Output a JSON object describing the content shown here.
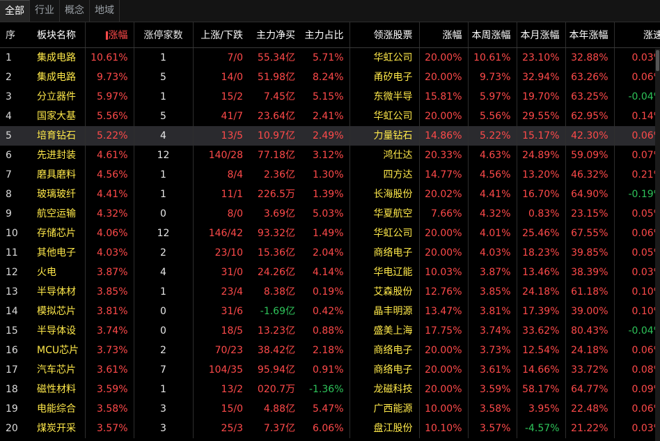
{
  "tabs": [
    "全部",
    "行业",
    "概念",
    "地域"
  ],
  "headers": {
    "idx": "序",
    "name": "板块名称",
    "change": "涨幅",
    "limit_up": "涨停家数",
    "up_down": "上涨/下跌",
    "net_inflow": "主力净买",
    "net_ratio": "主力占比",
    "leader": "领涨股票",
    "leader_change": "涨幅",
    "week": "本周涨幅",
    "month": "本月涨幅",
    "year": "本年涨幅",
    "speed": "涨速"
  },
  "rows": [
    {
      "idx": "1",
      "name": "集成电路",
      "change": "10.61%",
      "limit_up": "1",
      "up_down": "7/0",
      "net_inflow": "55.34亿",
      "net_ratio": "5.71%",
      "leader": "华虹公司",
      "leader_change": "20.00%",
      "week": "10.61%",
      "month": "23.10%",
      "year": "32.88%",
      "speed": "0.03%"
    },
    {
      "idx": "2",
      "name": "集成电路",
      "change": "9.73%",
      "limit_up": "5",
      "up_down": "14/0",
      "net_inflow": "51.98亿",
      "net_ratio": "8.24%",
      "leader": "甬矽电子",
      "leader_change": "20.00%",
      "week": "9.73%",
      "month": "32.94%",
      "year": "63.26%",
      "speed": "0.06%"
    },
    {
      "idx": "3",
      "name": "分立器件",
      "change": "5.97%",
      "limit_up": "1",
      "up_down": "15/2",
      "net_inflow": "7.45亿",
      "net_ratio": "5.15%",
      "leader": "东微半导",
      "leader_change": "15.81%",
      "week": "5.97%",
      "month": "19.70%",
      "year": "63.25%",
      "speed": "-0.04%"
    },
    {
      "idx": "4",
      "name": "国家大基",
      "change": "5.56%",
      "limit_up": "5",
      "up_down": "41/7",
      "net_inflow": "23.64亿",
      "net_ratio": "2.41%",
      "leader": "华虹公司",
      "leader_change": "20.00%",
      "week": "5.56%",
      "month": "29.55%",
      "year": "62.95%",
      "speed": "0.14%"
    },
    {
      "idx": "5",
      "name": "培育钻石",
      "change": "5.22%",
      "limit_up": "4",
      "up_down": "13/5",
      "net_inflow": "10.97亿",
      "net_ratio": "2.49%",
      "leader": "力量钻石",
      "leader_change": "14.86%",
      "week": "5.22%",
      "month": "15.17%",
      "year": "42.30%",
      "speed": "0.06%"
    },
    {
      "idx": "6",
      "name": "先进封装",
      "change": "4.61%",
      "limit_up": "12",
      "up_down": "140/28",
      "net_inflow": "77.18亿",
      "net_ratio": "3.12%",
      "leader": "鸿仕达",
      "leader_change": "20.33%",
      "week": "4.63%",
      "month": "24.89%",
      "year": "59.09%",
      "speed": "0.07%"
    },
    {
      "idx": "7",
      "name": "磨具磨料",
      "change": "4.56%",
      "limit_up": "1",
      "up_down": "8/4",
      "net_inflow": "2.36亿",
      "net_ratio": "1.30%",
      "leader": "四方达",
      "leader_change": "14.77%",
      "week": "4.56%",
      "month": "13.20%",
      "year": "46.32%",
      "speed": "0.21%"
    },
    {
      "idx": "8",
      "name": "玻璃玻纤",
      "change": "4.41%",
      "limit_up": "1",
      "up_down": "11/1",
      "net_inflow": "226.5万",
      "net_ratio": "1.39%",
      "leader": "长海股份",
      "leader_change": "20.02%",
      "week": "4.41%",
      "month": "16.70%",
      "year": "64.90%",
      "speed": "-0.19%"
    },
    {
      "idx": "9",
      "name": "航空运输",
      "change": "4.32%",
      "limit_up": "0",
      "up_down": "8/0",
      "net_inflow": "3.69亿",
      "net_ratio": "5.03%",
      "leader": "华夏航空",
      "leader_change": "7.66%",
      "week": "4.32%",
      "month": "0.83%",
      "year": "23.15%",
      "speed": "0.05%"
    },
    {
      "idx": "10",
      "name": "存储芯片",
      "change": "4.06%",
      "limit_up": "12",
      "up_down": "146/42",
      "net_inflow": "93.32亿",
      "net_ratio": "1.49%",
      "leader": "华虹公司",
      "leader_change": "20.00%",
      "week": "4.01%",
      "month": "25.46%",
      "year": "67.55%",
      "speed": "0.06%"
    },
    {
      "idx": "11",
      "name": "其他电子",
      "change": "4.03%",
      "limit_up": "2",
      "up_down": "23/10",
      "net_inflow": "15.36亿",
      "net_ratio": "2.04%",
      "leader": "商络电子",
      "leader_change": "20.00%",
      "week": "4.03%",
      "month": "18.23%",
      "year": "39.85%",
      "speed": "0.05%"
    },
    {
      "idx": "12",
      "name": "火电",
      "change": "3.87%",
      "limit_up": "4",
      "up_down": "31/0",
      "net_inflow": "24.26亿",
      "net_ratio": "4.14%",
      "leader": "华电辽能",
      "leader_change": "10.03%",
      "week": "3.87%",
      "month": "13.46%",
      "year": "38.39%",
      "speed": "0.03%"
    },
    {
      "idx": "13",
      "name": "半导体材",
      "change": "3.85%",
      "limit_up": "1",
      "up_down": "23/4",
      "net_inflow": "8.38亿",
      "net_ratio": "0.19%",
      "leader": "艾森股份",
      "leader_change": "12.76%",
      "week": "3.85%",
      "month": "24.18%",
      "year": "61.18%",
      "speed": "0.10%"
    },
    {
      "idx": "14",
      "name": "模拟芯片",
      "change": "3.81%",
      "limit_up": "0",
      "up_down": "31/6",
      "net_inflow": "-1.69亿",
      "net_ratio": "0.42%",
      "leader": "晶丰明源",
      "leader_change": "13.47%",
      "week": "3.81%",
      "month": "17.39%",
      "year": "39.00%",
      "speed": "0.10%"
    },
    {
      "idx": "15",
      "name": "半导体设",
      "change": "3.74%",
      "limit_up": "0",
      "up_down": "18/5",
      "net_inflow": "13.23亿",
      "net_ratio": "0.88%",
      "leader": "盛美上海",
      "leader_change": "17.75%",
      "week": "3.74%",
      "month": "33.62%",
      "year": "80.43%",
      "speed": "-0.04%"
    },
    {
      "idx": "16",
      "name": "MCU芯片",
      "change": "3.73%",
      "limit_up": "2",
      "up_down": "70/23",
      "net_inflow": "38.42亿",
      "net_ratio": "2.18%",
      "leader": "商络电子",
      "leader_change": "20.00%",
      "week": "3.73%",
      "month": "12.54%",
      "year": "24.18%",
      "speed": "0.06%"
    },
    {
      "idx": "17",
      "name": "汽车芯片",
      "change": "3.61%",
      "limit_up": "7",
      "up_down": "104/35",
      "net_inflow": "95.94亿",
      "net_ratio": "0.91%",
      "leader": "商络电子",
      "leader_change": "20.00%",
      "week": "3.61%",
      "month": "14.66%",
      "year": "33.72%",
      "speed": "0.08%"
    },
    {
      "idx": "18",
      "name": "磁性材料",
      "change": "3.59%",
      "limit_up": "1",
      "up_down": "13/2",
      "net_inflow": "020.7万",
      "net_ratio": "-1.36%",
      "leader": "龙磁科技",
      "leader_change": "20.00%",
      "week": "3.59%",
      "month": "58.17%",
      "year": "64.77%",
      "speed": "0.09%"
    },
    {
      "idx": "19",
      "name": "电能综合",
      "change": "3.58%",
      "limit_up": "3",
      "up_down": "15/0",
      "net_inflow": "4.88亿",
      "net_ratio": "5.47%",
      "leader": "广西能源",
      "leader_change": "10.00%",
      "week": "3.58%",
      "month": "3.95%",
      "year": "22.48%",
      "speed": "0.06%"
    },
    {
      "idx": "20",
      "name": "煤炭开采",
      "change": "3.57%",
      "limit_up": "3",
      "up_down": "25/3",
      "net_inflow": "7.37亿",
      "net_ratio": "6.06%",
      "leader": "盘江股份",
      "leader_change": "10.10%",
      "week": "3.57%",
      "month": "-4.57%",
      "year": "21.22%",
      "speed": "0.03%"
    }
  ],
  "selected_row": 5,
  "colors": {
    "up": "#ff4a4a",
    "down": "#2ec45a",
    "name": "#ffe94a",
    "bg": "#000000"
  }
}
